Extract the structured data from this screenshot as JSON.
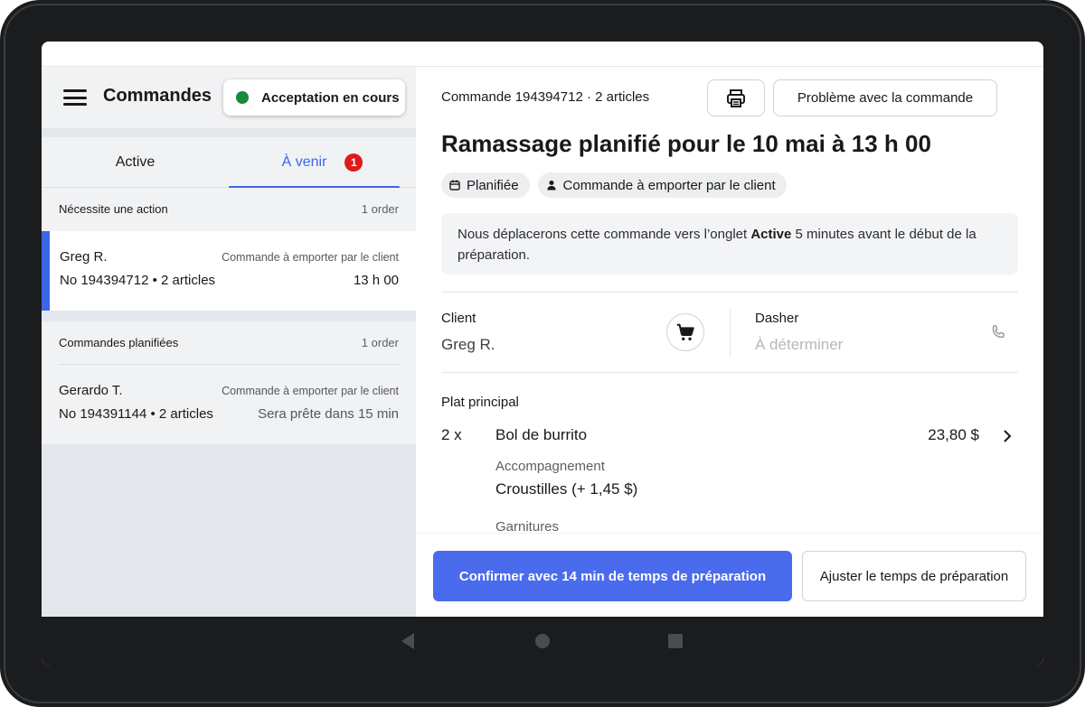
{
  "sidebar": {
    "title": "Commandes",
    "status_label": "Acceptation en cours",
    "status_color": "#1a8a3a",
    "tabs": [
      {
        "label": "Active"
      },
      {
        "label": "À venir",
        "badge": "1"
      }
    ],
    "sections": [
      {
        "title": "Nécessite une action",
        "count": "1 order",
        "orders": [
          {
            "customer": "Greg R.",
            "type": "Commande à emporter par le client",
            "number": "No 194394712 • 2 articles",
            "time": "13 h 00"
          }
        ]
      },
      {
        "title": "Commandes planifiées",
        "count": "1 order",
        "orders": [
          {
            "customer": "Gerardo T.",
            "type": "Commande à emporter par le client",
            "number": "No 194391144 • 2 articles",
            "time": "Sera prête dans 15 min"
          }
        ]
      }
    ]
  },
  "order": {
    "header": "Commande 194394712 · 2 articles",
    "problem_label": "Problème avec la commande",
    "heading": "Ramassage planifié pour le 10 mai à 13 h 00",
    "chips": [
      {
        "label": "Planifiée",
        "icon": "calendar-icon"
      },
      {
        "label": "Commande à emporter par le client",
        "icon": "person-icon"
      }
    ],
    "notice": {
      "before": "Nous déplacerons cette commande vers l’onglet ",
      "bold": "Active",
      "after": " 5 minutes avant le début de la préparation."
    },
    "client_label": "Client",
    "client_name": "Greg R.",
    "dasher_label": "Dasher",
    "dasher_value": "À déterminer",
    "category": "Plat principal",
    "item": {
      "qty": "2 x",
      "name": "Bol de burrito",
      "price": "23,80 $",
      "option_group": "Accompagnement",
      "option_value": "Croustilles (+ 1,45 $)",
      "next_group": "Garnitures"
    }
  },
  "footer": {
    "confirm_label": "Confirmer avec 14 min de temps de préparation",
    "adjust_label": "Ajuster le temps de préparation"
  },
  "colors": {
    "accent": "#3a66e8",
    "badge": "#e01a1a",
    "confirm": "#4a6bec"
  }
}
